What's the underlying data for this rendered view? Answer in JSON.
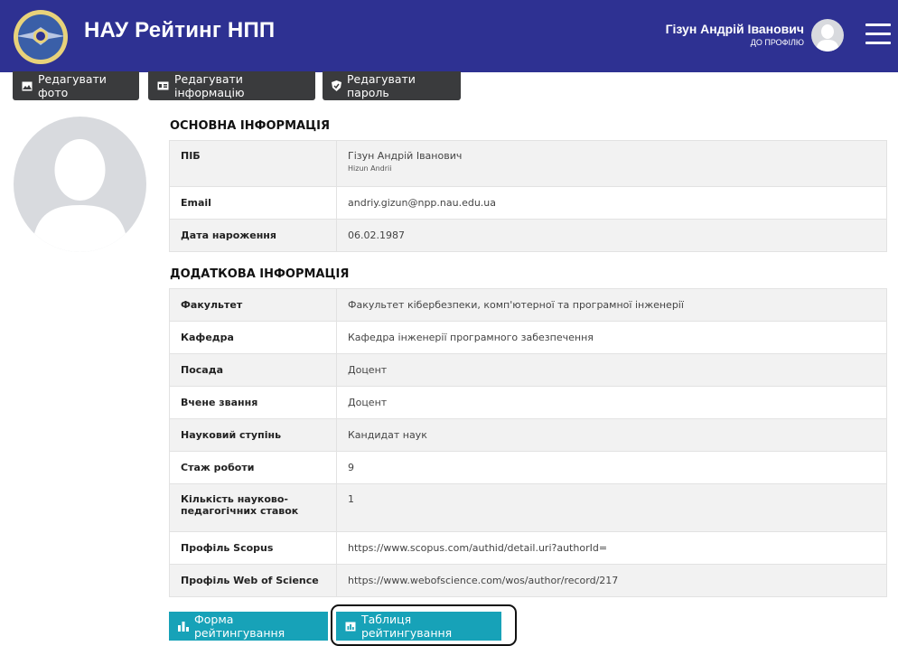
{
  "header": {
    "title": "НАУ Рейтинг НПП",
    "user_name": "Гізун Андрій Іванович",
    "profile_link": "ДО ПРОФІЛЮ",
    "background_color": "#2e3192"
  },
  "toolbar": {
    "edit_photo": "Редагувати фото",
    "edit_info": "Редагувати інформацію",
    "edit_password": "Редагувати пароль"
  },
  "basic_info": {
    "title": "ОСНОВНА ІНФОРМАЦІЯ",
    "rows": [
      {
        "label": "ПІБ",
        "value": "Гізун Андрій Іванович",
        "sub": "Hizun Andrii"
      },
      {
        "label": "Email",
        "value": "andriy.gizun@npp.nau.edu.ua"
      },
      {
        "label": "Дата нароження",
        "value": "06.02.1987"
      }
    ]
  },
  "extra_info": {
    "title": "ДОДАТКОВА ІНФОРМАЦІЯ",
    "rows": [
      {
        "label": "Факультет",
        "value": "Факультет кібербезпеки, комп'ютерної та програмної інженерії"
      },
      {
        "label": "Кафедра",
        "value": "Кафедра інженерії програмного забезпечення"
      },
      {
        "label": "Посада",
        "value": "Доцент"
      },
      {
        "label": "Вчене звання",
        "value": "Доцент"
      },
      {
        "label": "Науковий ступінь",
        "value": "Кандидат наук"
      },
      {
        "label": "Стаж роботи",
        "value": "9"
      },
      {
        "label": "Кількість науково-педагогічних ставок",
        "value": "1"
      },
      {
        "label": "Профіль Scopus",
        "value": "https://www.scopus.com/authid/detail.uri?authorId="
      },
      {
        "label": "Профіль Web of Science",
        "value": "https://www.webofscience.com/wos/author/record/217"
      }
    ]
  },
  "actions": {
    "rating_form": "Форма рейтингування",
    "rating_table": "Таблиця рейтингування",
    "accent_color": "#17a2b8"
  }
}
